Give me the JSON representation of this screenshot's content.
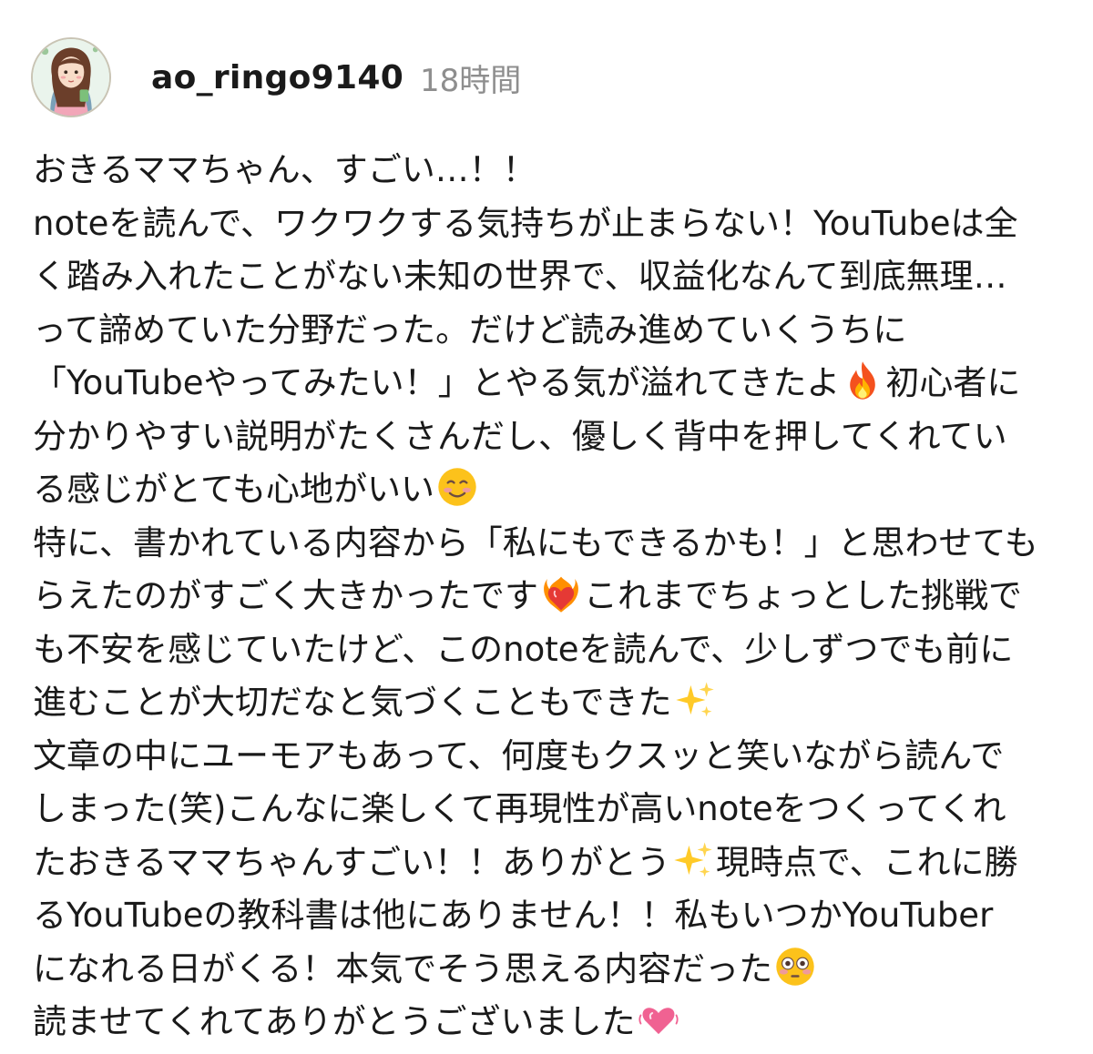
{
  "comment": {
    "username": "ao_ringo9140",
    "time": "18時間",
    "lines": [
      "おきるママちゃん、すごい…！！",
      "noteを読んで、ワクワクする気持ちが止まらない！YouTubeは全",
      "く踏み入れたことがない未知の世界で、収益化なんて到底無理…",
      "って諦めていた分野だった。だけど読み進めていくうちに",
      {
        "before": "「YouTubeやってみたい！」とやる気が溢れてきたよ",
        "emoji": "fire-emoji",
        "after": "初心者に"
      },
      "分かりやすい説明がたくさんだし、優しく背中を押してくれてい",
      {
        "before": "る感じがとても心地がいい",
        "emoji": "smiling-face-emoji",
        "after": ""
      },
      "特に、書かれている内容から「私にもできるかも！」と思わせても",
      {
        "before": "らえたのがすごく大きかったです",
        "emoji": "heart-on-fire-emoji",
        "after": "これまでちょっとした挑戦で"
      },
      "も不安を感じていたけど、このnoteを読んで、少しずつでも前に",
      {
        "before": "進むことが大切だなと気づくこともできた",
        "emoji": "sparkles-emoji",
        "after": ""
      },
      "文章の中にユーモアもあって、何度もクスッと笑いながら読んで",
      "しまった(笑)こんなに楽しくて再現性が高いnoteをつくってくれ",
      {
        "before": "たおきるママちゃんすごい！！ありがとう",
        "emoji": "sparkles-emoji",
        "after": "現時点で、これに勝"
      },
      "るYouTubeの教科書は他にありません！！私もいつかYouTuber",
      {
        "before": "になれる日がくる！本気でそう思える内容だった",
        "emoji": "flushed-face-emoji",
        "after": ""
      },
      {
        "before": "読ませてくれてありがとうございました",
        "emoji": "growing-heart-emoji",
        "after": ""
      }
    ]
  },
  "colors": {
    "text": "#1a1a1a",
    "time": "#8e8e8e",
    "background": "#ffffff"
  }
}
